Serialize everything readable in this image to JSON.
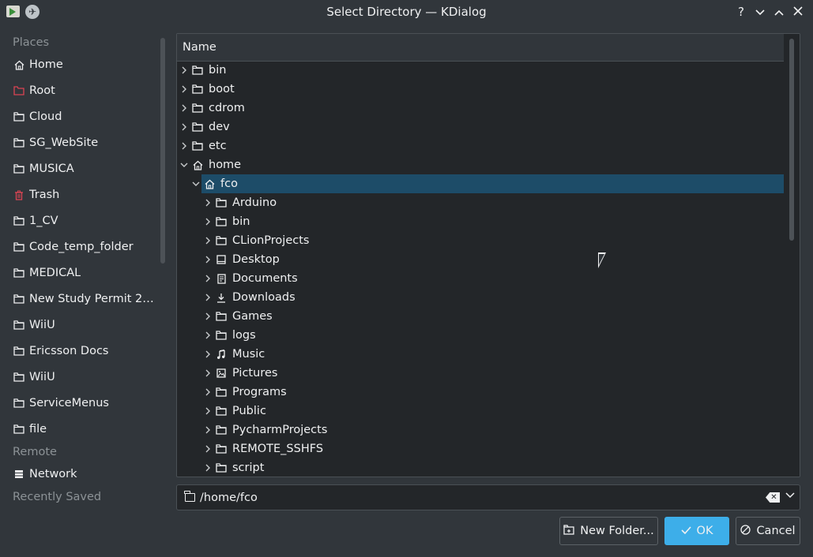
{
  "window": {
    "title": "Select Directory — KDialog",
    "help_glyph": "?",
    "minimize_glyph": "⌄",
    "maximize_glyph": "⌃",
    "close_glyph": "✕"
  },
  "sidebar": {
    "places_header": "Places",
    "places": [
      {
        "label": "Home",
        "icon": "home-icon"
      },
      {
        "label": "Root",
        "icon": "folder-red-icon"
      },
      {
        "label": "Cloud",
        "icon": "folder-icon"
      },
      {
        "label": "SG_WebSite",
        "icon": "folder-icon"
      },
      {
        "label": "MUSICA",
        "icon": "folder-icon"
      },
      {
        "label": "Trash",
        "icon": "trash-icon"
      },
      {
        "label": "1_CV",
        "icon": "folder-icon"
      },
      {
        "label": "Code_temp_folder",
        "icon": "folder-icon"
      },
      {
        "label": "MEDICAL",
        "icon": "folder-icon"
      },
      {
        "label": "New Study Permit 20...",
        "icon": "folder-icon"
      },
      {
        "label": "WiiU",
        "icon": "folder-icon"
      },
      {
        "label": "Ericsson Docs",
        "icon": "folder-icon"
      },
      {
        "label": "WiiU",
        "icon": "folder-icon"
      },
      {
        "label": "ServiceMenus",
        "icon": "folder-icon"
      },
      {
        "label": "file",
        "icon": "folder-icon"
      }
    ],
    "remote_header": "Remote",
    "remote": [
      {
        "label": "Network",
        "icon": "network-icon"
      }
    ],
    "recent_header": "Recently Saved"
  },
  "tree": {
    "column_header": "Name",
    "rows": [
      {
        "label": "bin",
        "level": 0,
        "expanded": false,
        "icon": "folder-icon"
      },
      {
        "label": "boot",
        "level": 0,
        "expanded": false,
        "icon": "folder-icon"
      },
      {
        "label": "cdrom",
        "level": 0,
        "expanded": false,
        "icon": "folder-icon"
      },
      {
        "label": "dev",
        "level": 0,
        "expanded": false,
        "icon": "folder-icon"
      },
      {
        "label": "etc",
        "level": 0,
        "expanded": false,
        "icon": "folder-icon"
      },
      {
        "label": "home",
        "level": 0,
        "expanded": true,
        "icon": "home-icon"
      },
      {
        "label": "fco",
        "level": 1,
        "expanded": true,
        "icon": "home-icon",
        "selected": true
      },
      {
        "label": "Arduino",
        "level": 2,
        "expanded": false,
        "icon": "folder-icon"
      },
      {
        "label": "bin",
        "level": 2,
        "expanded": false,
        "icon": "folder-icon"
      },
      {
        "label": "CLionProjects",
        "level": 2,
        "expanded": false,
        "icon": "folder-icon"
      },
      {
        "label": "Desktop",
        "level": 2,
        "expanded": false,
        "icon": "desktop-icon"
      },
      {
        "label": "Documents",
        "level": 2,
        "expanded": false,
        "icon": "documents-icon"
      },
      {
        "label": "Downloads",
        "level": 2,
        "expanded": false,
        "icon": "download-icon"
      },
      {
        "label": "Games",
        "level": 2,
        "expanded": false,
        "icon": "folder-icon"
      },
      {
        "label": "logs",
        "level": 2,
        "expanded": false,
        "icon": "folder-icon"
      },
      {
        "label": "Music",
        "level": 2,
        "expanded": false,
        "icon": "music-icon"
      },
      {
        "label": "Pictures",
        "level": 2,
        "expanded": false,
        "icon": "pictures-icon"
      },
      {
        "label": "Programs",
        "level": 2,
        "expanded": false,
        "icon": "folder-icon"
      },
      {
        "label": "Public",
        "level": 2,
        "expanded": false,
        "icon": "folder-icon"
      },
      {
        "label": "PycharmProjects",
        "level": 2,
        "expanded": false,
        "icon": "folder-icon"
      },
      {
        "label": "REMOTE_SSHFS",
        "level": 2,
        "expanded": false,
        "icon": "folder-icon"
      },
      {
        "label": "script",
        "level": 2,
        "expanded": false,
        "icon": "folder-icon"
      }
    ]
  },
  "path": {
    "value": "/home/fco"
  },
  "buttons": {
    "new_folder": "New Folder...",
    "ok": "OK",
    "cancel": "Cancel"
  },
  "colors": {
    "window_bg": "#31363b",
    "view_bg": "#232629",
    "selection": "#1d4c68",
    "accent": "#3daee9",
    "root_red": "#da4453",
    "muted_text": "#8c9296"
  }
}
